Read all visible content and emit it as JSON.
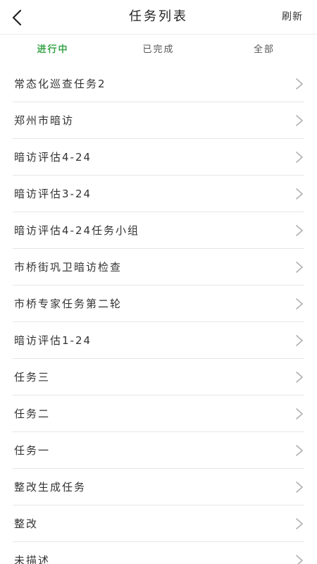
{
  "header": {
    "title": "任务列表",
    "refresh_label": "刷新"
  },
  "tabs": [
    {
      "label": "进行中",
      "active": true
    },
    {
      "label": "已完成",
      "active": false
    },
    {
      "label": "全部",
      "active": false
    }
  ],
  "tasks": [
    {
      "label": "常态化巡查任务2"
    },
    {
      "label": "郑州市暗访"
    },
    {
      "label": "暗访评估4-24"
    },
    {
      "label": "暗访评估3-24"
    },
    {
      "label": "暗访评估4-24任务小组"
    },
    {
      "label": "市桥街巩卫暗访检查"
    },
    {
      "label": "市桥专家任务第二轮"
    },
    {
      "label": "暗访评估1-24"
    },
    {
      "label": "任务三"
    },
    {
      "label": "任务二"
    },
    {
      "label": "任务一"
    },
    {
      "label": "整改生成任务"
    },
    {
      "label": "整改"
    },
    {
      "label": "未描述"
    }
  ],
  "colors": {
    "active_tab": "#3aa64a",
    "divider": "#e6e6e6",
    "chevron": "#b0b0b0"
  },
  "icons": {
    "back": "back-arrow-icon",
    "row": "chevron-right-icon"
  }
}
